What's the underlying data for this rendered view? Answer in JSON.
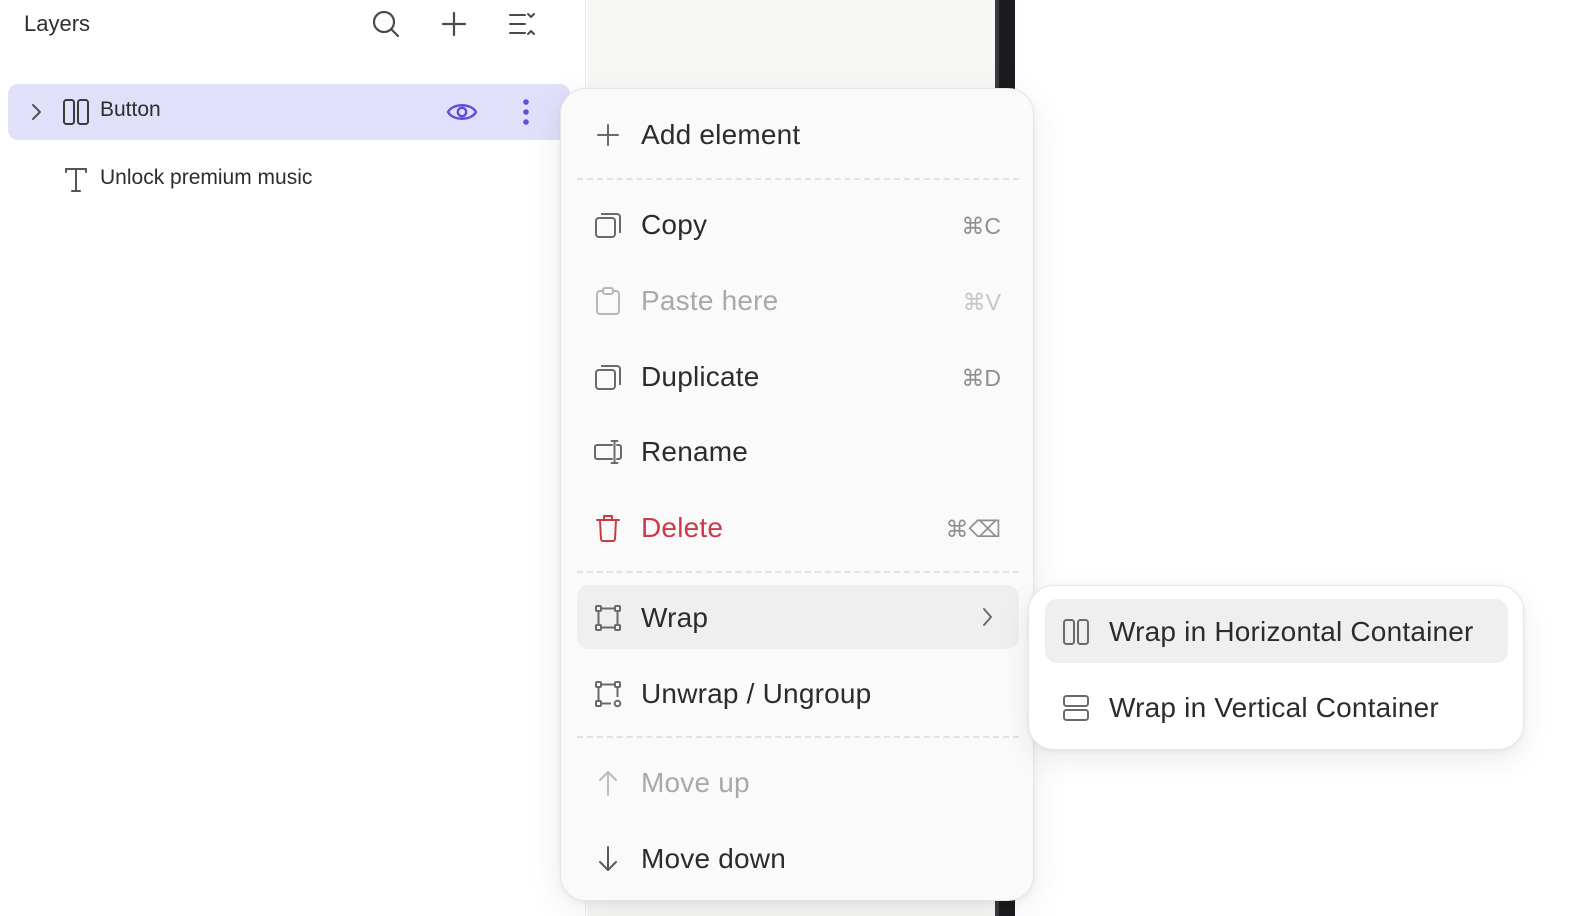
{
  "layers_panel": {
    "title": "Layers",
    "header_icons": [
      "search-icon",
      "add-icon",
      "collapse-all-icon"
    ],
    "items": [
      {
        "label": "Button",
        "icon": "horizontal-container-icon",
        "selected": true,
        "visible": true
      },
      {
        "label": "Unlock premium music",
        "icon": "text-icon",
        "selected": false
      }
    ]
  },
  "context_menu": {
    "add_element": {
      "label": "Add element",
      "icon": "plus-icon"
    },
    "copy": {
      "label": "Copy",
      "shortcut": "⌘C",
      "icon": "copy-icon"
    },
    "paste": {
      "label": "Paste here",
      "shortcut": "⌘V",
      "icon": "clipboard-icon",
      "disabled": true
    },
    "duplicate": {
      "label": "Duplicate",
      "shortcut": "⌘D",
      "icon": "duplicate-icon"
    },
    "rename": {
      "label": "Rename",
      "icon": "rename-icon"
    },
    "delete": {
      "label": "Delete",
      "shortcut": "⌘⌫",
      "icon": "trash-icon",
      "color": "#cc3a46"
    },
    "wrap": {
      "label": "Wrap",
      "icon": "wrap-icon",
      "has_submenu": true
    },
    "unwrap": {
      "label": "Unwrap / Ungroup",
      "icon": "unwrap-icon"
    },
    "move_up": {
      "label": "Move up",
      "icon": "arrow-up-icon",
      "disabled": true
    },
    "move_down": {
      "label": "Move down",
      "icon": "arrow-down-icon"
    }
  },
  "wrap_submenu": {
    "horizontal": {
      "label": "Wrap in Horizontal Container",
      "icon": "horizontal-container-icon"
    },
    "vertical": {
      "label": "Wrap in Vertical Container",
      "icon": "vertical-container-icon"
    }
  },
  "colors": {
    "selection": "#e1e0fb",
    "accent": "#5b50d6",
    "danger": "#cc3a46"
  }
}
